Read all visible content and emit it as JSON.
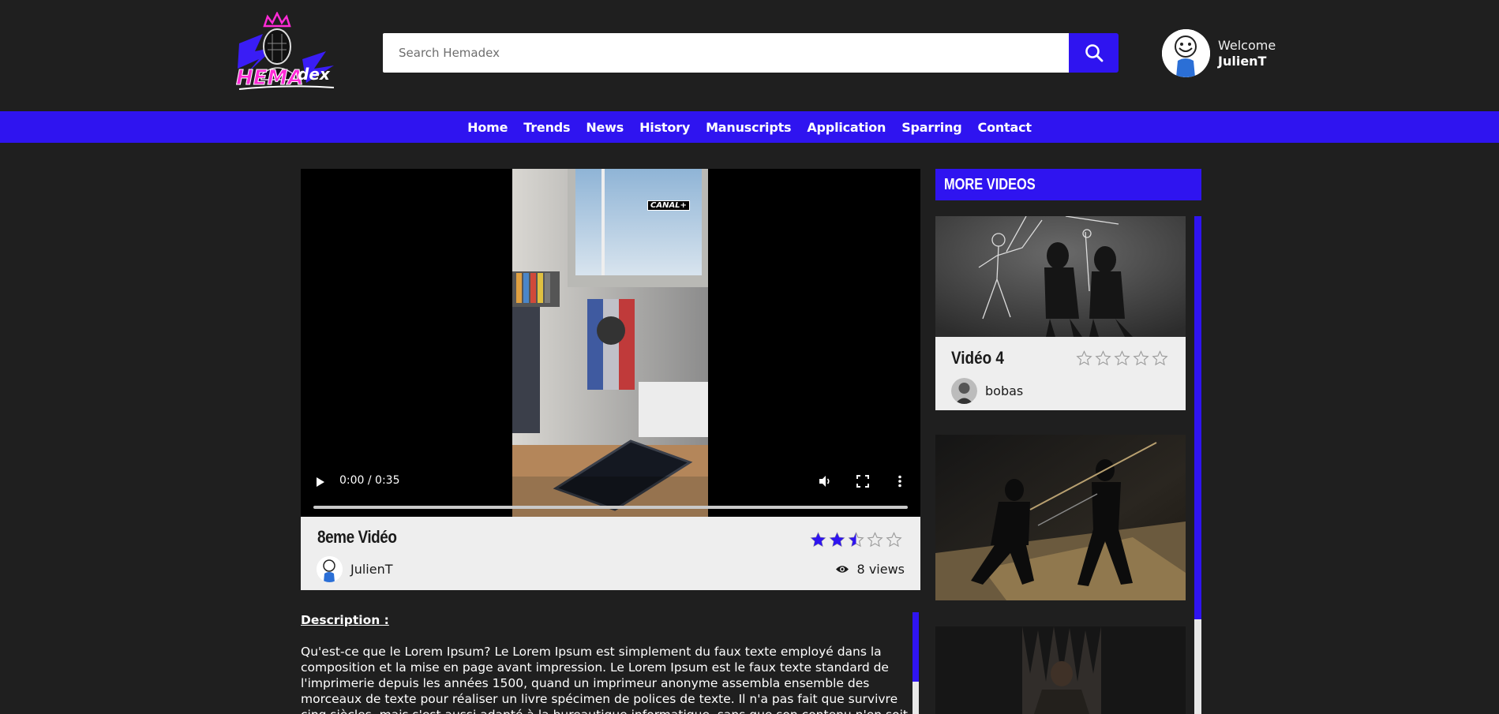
{
  "header": {
    "search_placeholder": "Search Hemadex",
    "welcome": "Welcome",
    "username": "JulienT"
  },
  "nav": {
    "items": [
      "Home",
      "Trends",
      "News",
      "History",
      "Manuscripts",
      "Application",
      "Sparring",
      "Contact"
    ]
  },
  "player": {
    "time": "0:00 / 0:35",
    "overlay_logo": "CANAL+",
    "progress": 0
  },
  "video": {
    "title": "8eme Vidéo",
    "rating": 2.5,
    "rating_max": 5,
    "author": "JulienT",
    "views": "8 views"
  },
  "description": {
    "label": "Description :",
    "text": "Qu'est-ce que le Lorem Ipsum? Le Lorem Ipsum est simplement du faux texte employé dans la composition et la mise en page avant impression. Le Lorem Ipsum est le faux texte standard de l'imprimerie depuis les années 1500, quand un imprimeur anonyme assembla ensemble des morceaux de texte pour réaliser un livre spécimen de polices de texte. Il n'a pas fait que survivre cinq siècles, mais s'est aussi adapté à la bureautique informatique, sans que son contenu n'en soit modifié. Il a été"
  },
  "sidebar": {
    "heading": "More videos",
    "cards": [
      {
        "title": "Vidéo 4",
        "author": "bobas",
        "rating": 0
      },
      {
        "title": "",
        "author": "",
        "rating": 0
      },
      {
        "title": "",
        "author": "",
        "rating": 0
      }
    ]
  },
  "colors": {
    "accent": "#2f14f0",
    "background": "#1f1f1f",
    "card": "#eeeeee"
  }
}
